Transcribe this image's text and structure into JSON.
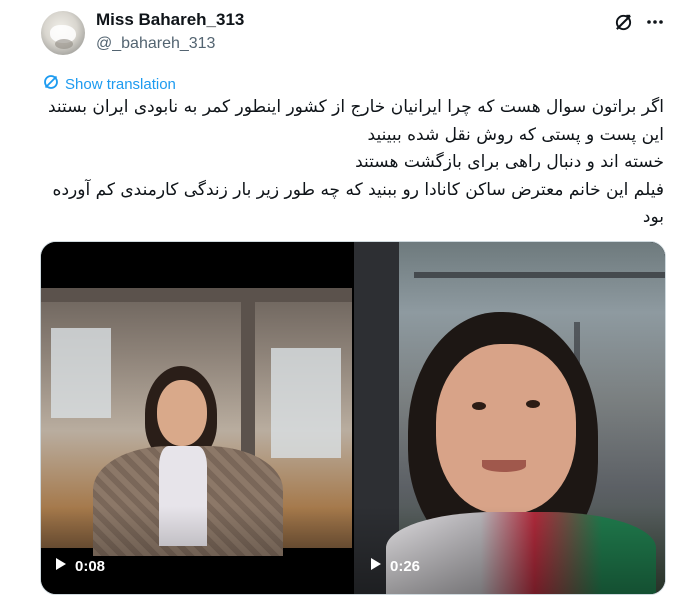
{
  "author": {
    "display_name": "Miss Bahareh_313",
    "handle": "@_bahareh_313"
  },
  "actions": {
    "grok_icon": "grok-icon",
    "more_icon": "more-horizontal-icon"
  },
  "translation": {
    "label": "Show translation",
    "icon": "translate-icon"
  },
  "tweet": {
    "lines": [
      "اگر براتون سوال هست که چرا ایرانیان خارج از کشور اینطور کمر به نابودی ایران بستند",
      "این پست و پستی که روش نقل شده ببینید",
      "خسته اند و دنبال راهی برای بازگشت هستند",
      "فیلم این خانم معترض ساکن کانادا رو ببنید که چه طور زیر بار زندگی کارمندی کم آورده",
      "بود"
    ]
  },
  "media": {
    "videos": [
      {
        "duration": "0:08"
      },
      {
        "duration": "0:26"
      }
    ]
  },
  "colors": {
    "link": "#1d9bf0",
    "secondary_text": "#536471",
    "border": "#cfd9de"
  }
}
